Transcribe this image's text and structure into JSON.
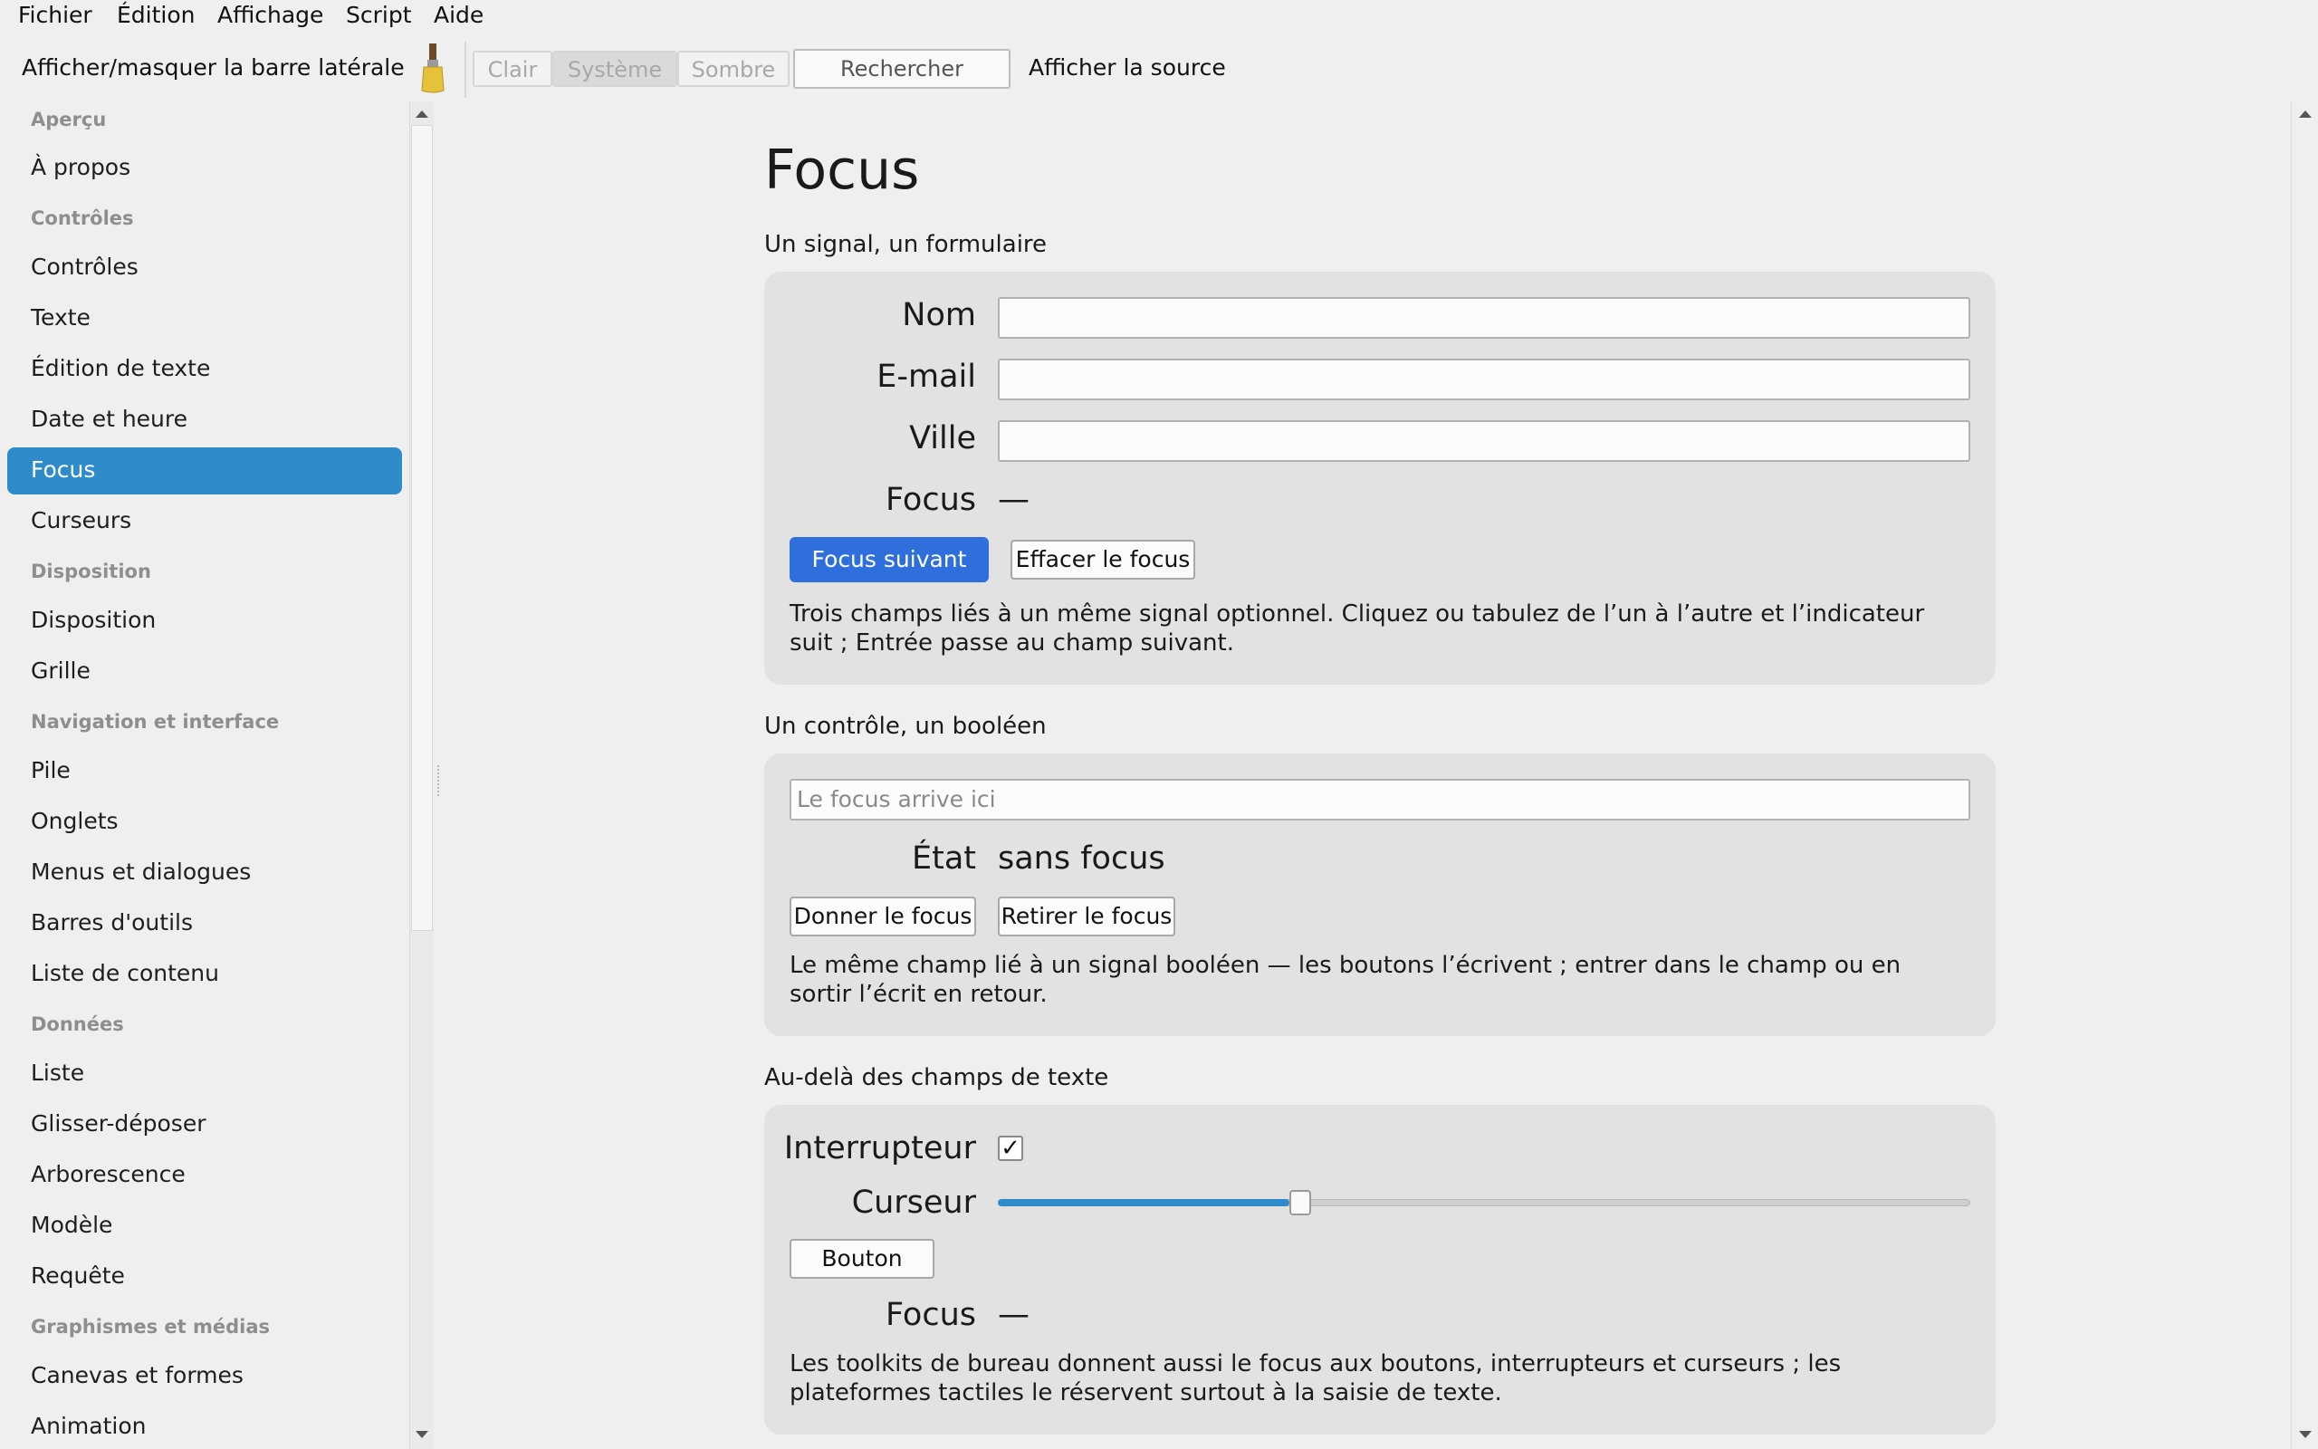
{
  "menu": [
    "Fichier",
    "Édition",
    "Affichage",
    "Script",
    "Aide"
  ],
  "toolbar": {
    "toggle_sidebar": "Afficher/masquer la barre latérale",
    "theme": [
      "Clair",
      "Système",
      "Sombre"
    ],
    "theme_selected": "Système",
    "search_label": "Rechercher",
    "show_source": "Afficher la source"
  },
  "sidebar": {
    "headers": {
      "apercu": "Aperçu",
      "controles": "Contrôles",
      "disposition": "Disposition",
      "navigation": "Navigation et interface",
      "donnees": "Données",
      "graphismes": "Graphismes et médias"
    },
    "items": {
      "a_propos": "À propos",
      "controles": "Contrôles",
      "texte": "Texte",
      "edition": "Édition de texte",
      "date": "Date et heure",
      "focus": "Focus",
      "curseurs": "Curseurs",
      "disposition": "Disposition",
      "grille": "Grille",
      "pile": "Pile",
      "onglets": "Onglets",
      "menus": "Menus et dialogues",
      "barres": "Barres d'outils",
      "liste_contenu": "Liste de contenu",
      "liste": "Liste",
      "glisser": "Glisser-déposer",
      "arborescence": "Arborescence",
      "modele": "Modèle",
      "requete": "Requête",
      "canevas": "Canevas et formes",
      "animation": "Animation"
    },
    "selected": "Focus"
  },
  "page": {
    "title": "Focus",
    "section1": {
      "title": "Un signal, un formulaire",
      "label_nom": "Nom",
      "label_email": "E-mail",
      "label_ville": "Ville",
      "label_focus": "Focus",
      "focus_value": "—",
      "btn_next": "Focus suivant",
      "btn_clear": "Effacer le focus",
      "desc1": "Trois champs liés à un même signal optionnel. Cliquez ou tabulez de l’un à l’autre et l’indicateur",
      "desc2": "suit ; Entrée passe au champ suivant."
    },
    "section2": {
      "title": "Un contrôle, un booléen",
      "placeholder": "Le focus arrive ici",
      "label_state": "État",
      "state_value": "sans focus",
      "btn_give": "Donner le focus",
      "btn_remove": "Retirer le focus",
      "desc1": "Le même champ lié à un signal booléen — les boutons l’écrivent ; entrer dans le champ ou en",
      "desc2": "sortir l’écrit en retour."
    },
    "section3": {
      "title": "Au-delà des champs de texte",
      "label_switch": "Interrupteur",
      "switch_checked": true,
      "checkmark": "✓",
      "label_slider": "Curseur",
      "slider_value": 0.3,
      "btn_button": "Bouton",
      "label_focus": "Focus",
      "focus_value": "—",
      "desc1": "Les toolkits de bureau donnent aussi le focus aux boutons, interrupteurs et curseurs ; les",
      "desc2": "plateformes tactiles le réservent surtout à la saisie de texte."
    }
  },
  "colors": {
    "accent": "#2f8cca",
    "primary_button": "#2f6fdc",
    "card_bg": "#e2e2e2",
    "window_bg": "#efefef"
  }
}
